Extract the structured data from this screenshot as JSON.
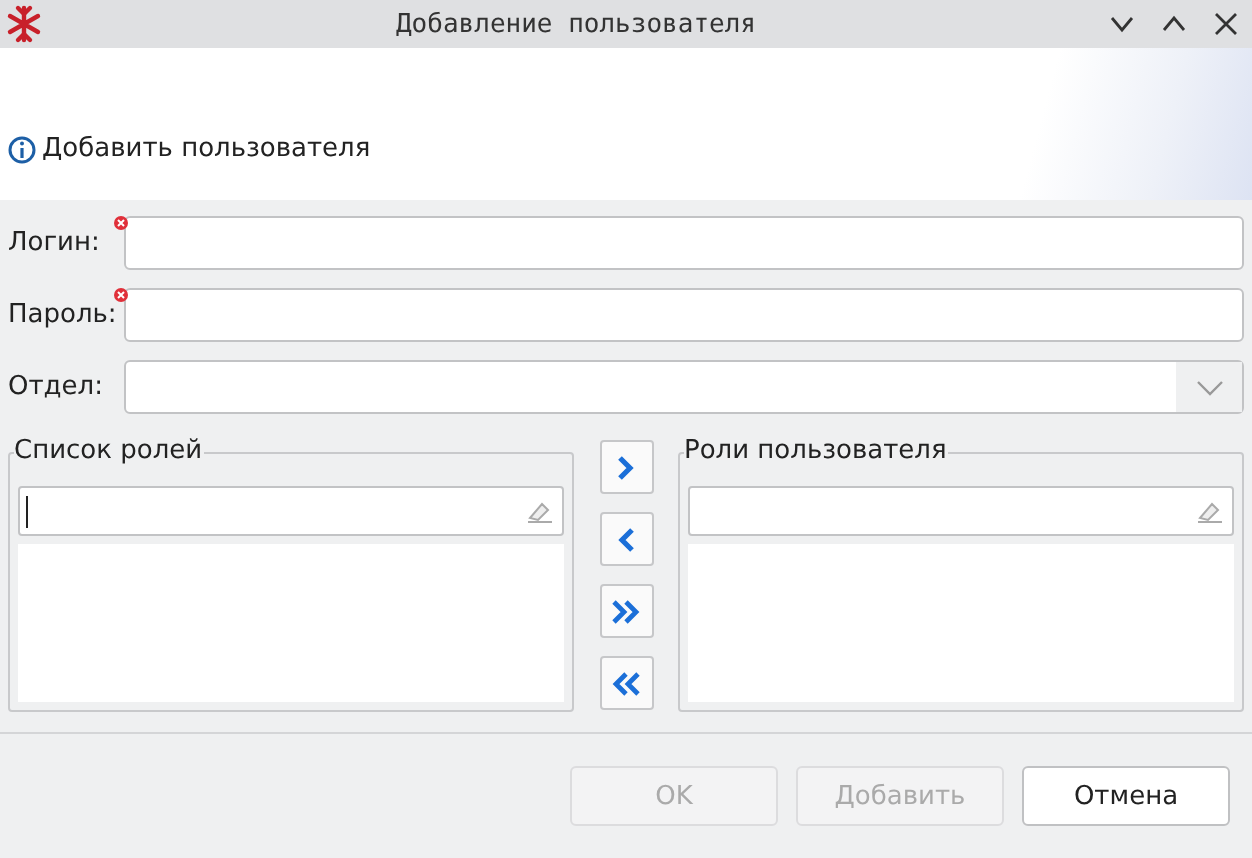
{
  "window": {
    "title": "Добавление пользователя"
  },
  "header": {
    "text": "Добавить пользователя"
  },
  "fields": [
    {
      "label": "Логин:",
      "kind": "text",
      "required": true
    },
    {
      "label": "Пароль:",
      "kind": "text",
      "required": true
    },
    {
      "label": "Отдел:",
      "kind": "combo",
      "required": false
    }
  ],
  "groups": [
    {
      "title": "Список ролей",
      "filter_focused": true
    },
    {
      "title": "Роли пользователя",
      "filter_focused": false
    }
  ],
  "transfer_buttons": [
    {
      "kind": "right"
    },
    {
      "kind": "left"
    },
    {
      "kind": "all-right"
    },
    {
      "kind": "all-left"
    }
  ],
  "buttons": [
    {
      "label": "OK",
      "disabled": true
    },
    {
      "label": "Добавить",
      "disabled": true
    },
    {
      "label": "Отмена",
      "disabled": false
    }
  ]
}
